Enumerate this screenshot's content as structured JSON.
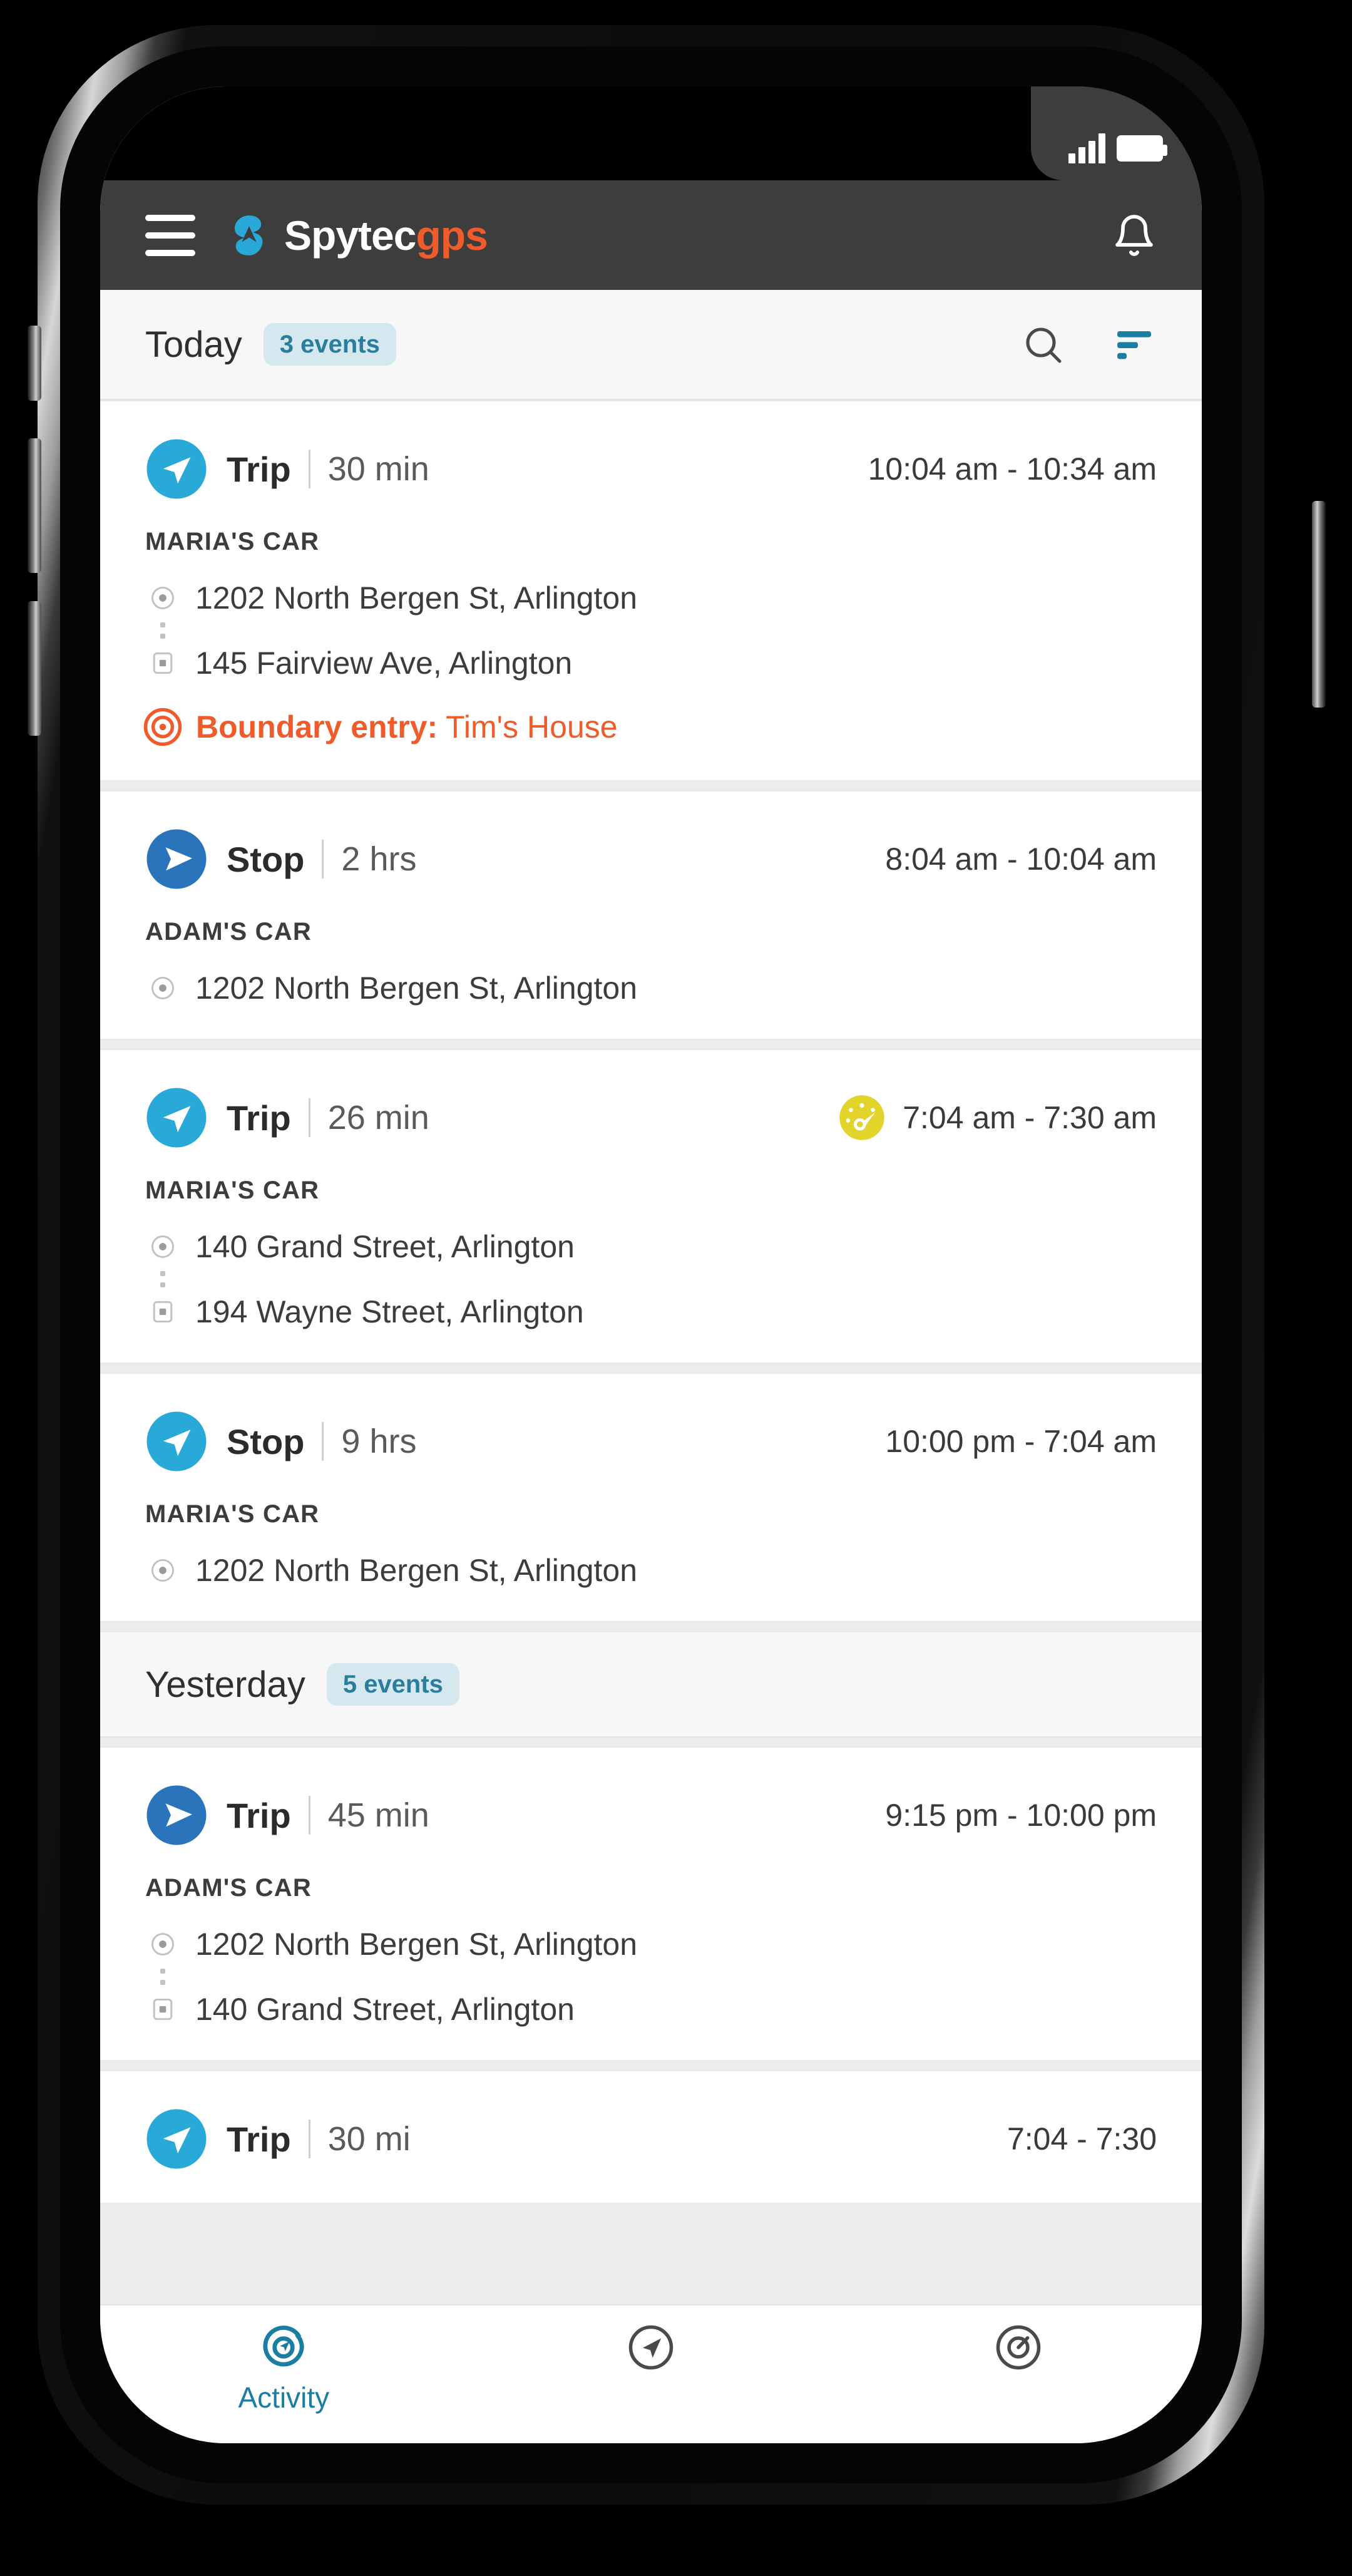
{
  "status_bar": {
    "signal_icon": "cellular-bars-icon",
    "battery_icon": "battery-full-icon"
  },
  "header": {
    "menu_icon": "hamburger-menu-icon",
    "logo_icon": "spytec-logo-mark-icon",
    "brand_first": "Spytec",
    "brand_second": "gps",
    "notifications_icon": "bell-icon"
  },
  "toolbar": {
    "day_label": "Today",
    "events_chip": "3 events",
    "search_icon": "search-icon",
    "filter_icon": "filter-icon"
  },
  "sections": [
    {
      "label": "Yesterday",
      "events_chip": "5 events"
    }
  ],
  "events": [
    {
      "icon": "trip-arrow-icon",
      "type": "Trip",
      "duration": "30 min",
      "time_range": "10:04 am - 10:34 am",
      "vehicle": "MARIA'S CAR",
      "start_address": "1202 North Bergen St, Arlington",
      "end_address": "145 Fairview Ave, Arlington",
      "alert_label": "Boundary entry:",
      "alert_value": "Tim's House",
      "alert_icon": "boundary-target-icon"
    },
    {
      "icon": "stop-arrow-icon",
      "type": "Stop",
      "duration": "2 hrs",
      "time_range": "8:04 am - 10:04 am",
      "vehicle": "ADAM'S CAR",
      "start_address": "1202 North Bergen St, Arlington"
    },
    {
      "icon": "trip-arrow-icon",
      "type": "Trip",
      "duration": "26 min",
      "time_range": "7:04 am - 7:30 am",
      "badge_icon": "speedometer-icon",
      "vehicle": "MARIA'S CAR",
      "start_address": "140 Grand Street, Arlington",
      "end_address": "194 Wayne Street, Arlington"
    },
    {
      "icon": "trip-arrow-icon",
      "type": "Stop",
      "duration": "9 hrs",
      "time_range": "10:00 pm - 7:04 am",
      "vehicle": "MARIA'S CAR",
      "start_address": "1202 North Bergen St, Arlington"
    },
    {
      "icon": "stop-arrow-icon",
      "type": "Trip",
      "duration": "45 min",
      "time_range": "9:15 pm - 10:00 pm",
      "vehicle": "ADAM'S CAR",
      "start_address": "1202 North Bergen St, Arlington",
      "end_address": "140 Grand Street, Arlington"
    },
    {
      "icon": "trip-arrow-icon",
      "type": "Trip",
      "duration": "30 mi",
      "time_range": "7:04 - 7:30"
    }
  ],
  "bottom_nav": [
    {
      "icon": "activity-icon",
      "label": "Activity",
      "active": true
    },
    {
      "icon": "location-arrow-icon",
      "label": "",
      "active": false
    },
    {
      "icon": "target-boundary-icon",
      "label": "",
      "active": false
    }
  ],
  "colors": {
    "brand_blue": "#29a9d8",
    "brand_orange": "#ef5b2b",
    "stop_blue": "#2a74bb",
    "chip_bg": "#d5e8ef",
    "chip_text": "#2a7d9b",
    "alert_orange": "#ef5b2b",
    "speed_yellow": "#e3d42b",
    "header_dark": "#3d3d3d"
  }
}
